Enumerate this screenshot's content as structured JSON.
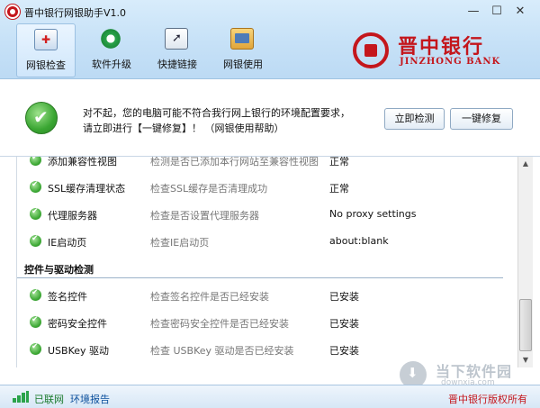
{
  "window": {
    "title": "晋中银行网银助手V1.0",
    "controls": {
      "minimize": "—",
      "maximize": "☐",
      "close": "✕"
    }
  },
  "toolbar": {
    "items": [
      {
        "label": "网银检查",
        "icon": "home-check-icon",
        "active": true
      },
      {
        "label": "软件升级",
        "icon": "gear-icon",
        "active": false
      },
      {
        "label": "快捷链接",
        "icon": "link-icon",
        "active": false
      },
      {
        "label": "网银使用",
        "icon": "book-icon",
        "active": false
      }
    ]
  },
  "brand": {
    "name_cn": "晋中银行",
    "name_en": "JINZHONG BANK",
    "color": "#c4161c"
  },
  "alert": {
    "status_icon": "check-circle-icon",
    "line1": "对不起，您的电脑可能不符合我行网上银行的环境配置要求，",
    "line2": "请立即进行【一键修复】！ （网银使用帮助）",
    "buttons": {
      "check": "立即检测",
      "repair": "一键修复"
    }
  },
  "list": {
    "rows_top": [
      {
        "name": "添加兼容性视图",
        "desc": "检测是否已添加本行网站至兼容性视图",
        "value": "正常"
      },
      {
        "name": "SSL缓存清理状态",
        "desc": "检查SSL缓存是否清理成功",
        "value": "正常"
      },
      {
        "name": "代理服务器",
        "desc": "检查是否设置代理服务器",
        "value": "No proxy settings"
      },
      {
        "name": "IE启动页",
        "desc": "检查IE启动页",
        "value": "about:blank"
      }
    ],
    "section_title": "控件与驱动检测",
    "rows_bottom": [
      {
        "name": "签名控件",
        "desc": "检查签名控件是否已经安装",
        "value": "已安装"
      },
      {
        "name": "密码安全控件",
        "desc": "检查密码安全控件是否已经安装",
        "value": "已安装"
      },
      {
        "name": "USBKey 驱动",
        "desc": "检查 USBKey 驱动是否已经安装",
        "value": "已安装"
      }
    ]
  },
  "statusbar": {
    "connection": "已联网",
    "report": "环境报告",
    "copyright": "晋中银行版权所有",
    "signal_color": "#2aa34a"
  },
  "watermark": {
    "name_cn": "当下软件园",
    "domain": "downxia.com"
  }
}
